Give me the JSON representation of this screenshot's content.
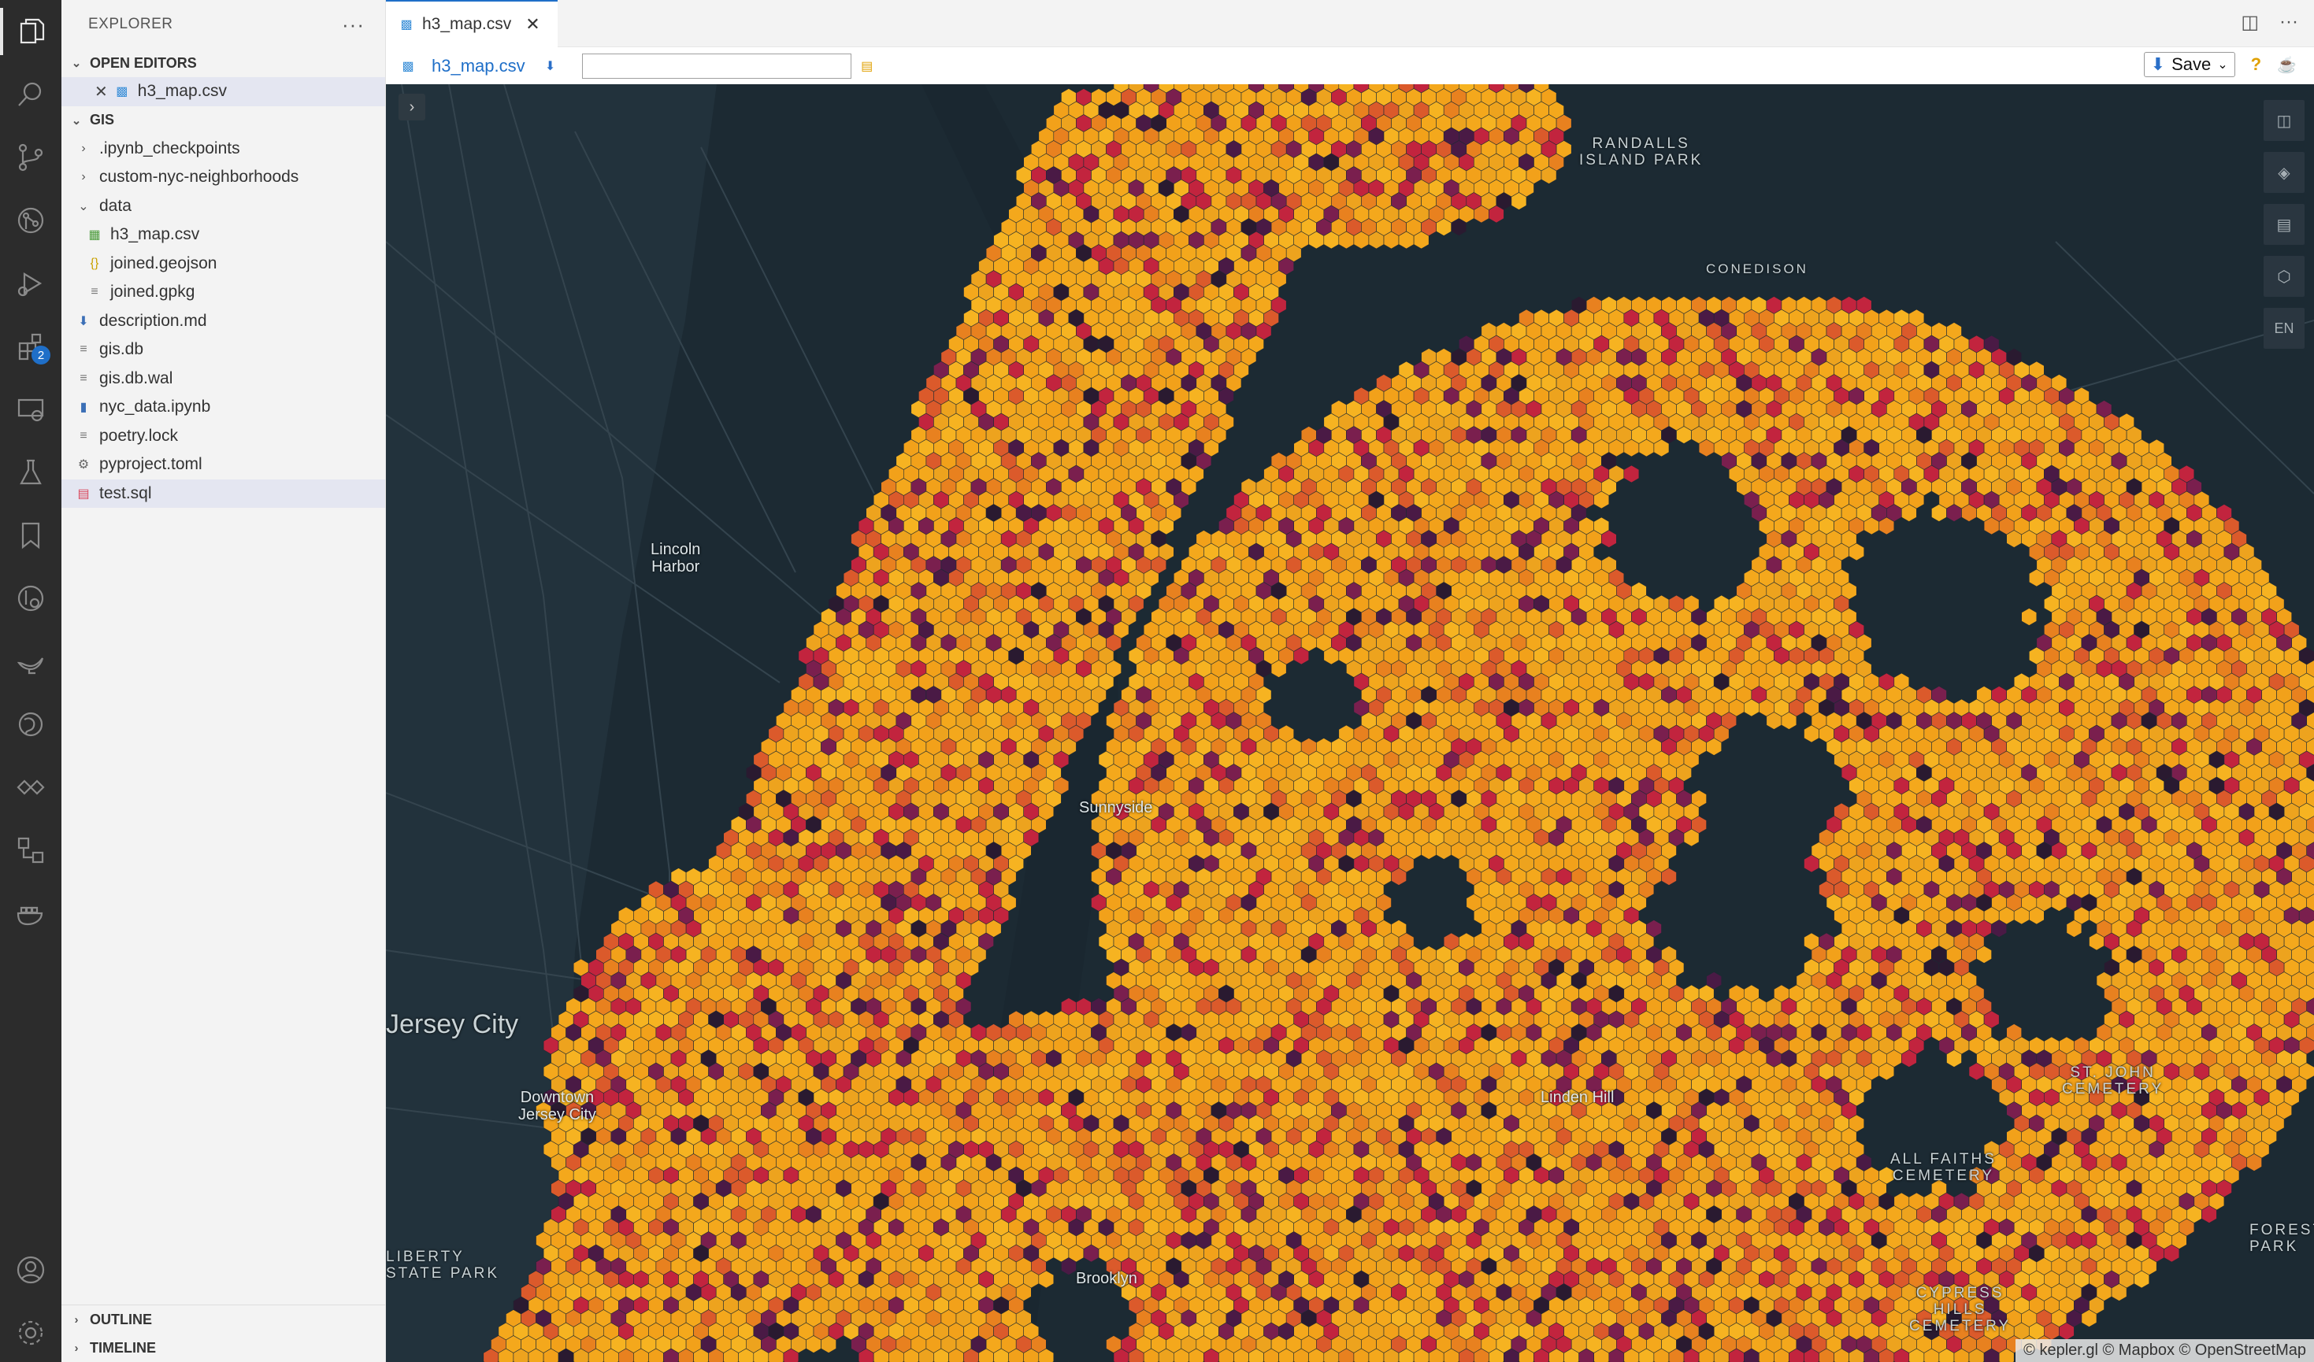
{
  "activity_bar": {
    "icons": [
      "explorer-icon",
      "search-icon",
      "source-control-icon",
      "git-graph-icon",
      "run-debug-icon",
      "extensions-icon",
      "remote-explorer-icon",
      "testing-icon",
      "bookmarks-icon",
      "gitlens-icon",
      "genie-lamp-icon",
      "python-icon",
      "kepler-icon",
      "diagram-icon",
      "docker-icon"
    ],
    "extensions_badge": "2",
    "bottom_icons": [
      "account-icon",
      "settings-gear-icon"
    ]
  },
  "sidebar": {
    "title": "EXPLORER",
    "open_editors": {
      "label": "OPEN EDITORS",
      "items": [
        {
          "name": "h3_map.csv"
        }
      ]
    },
    "workspace": {
      "label": "GIS",
      "items": [
        {
          "name": ".ipynb_checkpoints",
          "kind": "folder",
          "depth": 1
        },
        {
          "name": "custom-nyc-neighborhoods",
          "kind": "folder",
          "depth": 1
        },
        {
          "name": "data",
          "kind": "folder-open",
          "depth": 1
        },
        {
          "name": "h3_map.csv",
          "kind": "csv",
          "depth": 2
        },
        {
          "name": "joined.geojson",
          "kind": "json",
          "depth": 2
        },
        {
          "name": "joined.gpkg",
          "kind": "file",
          "depth": 2
        },
        {
          "name": "description.md",
          "kind": "md",
          "depth": 1
        },
        {
          "name": "gis.db",
          "kind": "file",
          "depth": 1
        },
        {
          "name": "gis.db.wal",
          "kind": "file",
          "depth": 1
        },
        {
          "name": "nyc_data.ipynb",
          "kind": "notebook",
          "depth": 1
        },
        {
          "name": "poetry.lock",
          "kind": "file",
          "depth": 1
        },
        {
          "name": "pyproject.toml",
          "kind": "toml",
          "depth": 1
        },
        {
          "name": "test.sql",
          "kind": "sql",
          "depth": 1
        }
      ]
    },
    "outline_label": "OUTLINE",
    "timeline_label": "TIMELINE"
  },
  "editor": {
    "tab_label": "h3_map.csv",
    "toolbar_file": "h3_map.csv",
    "input_value": "",
    "save_label": "Save",
    "help_label": "?"
  },
  "map": {
    "labels": {
      "randalls": "RANDALLS\nISLAND PARK",
      "conedison": "CONEDISON",
      "lincoln_harbor": "Lincoln\nHarbor",
      "jersey_city": "Jersey City",
      "downtown_jersey_city": "Downtown\nJersey City",
      "liberty_park": "LIBERTY\nSTATE PARK",
      "brooklyn": "Brooklyn",
      "sunnyside": "Sunnyside",
      "linden_hill": "Linden Hill",
      "all_faiths": "ALL FAITHS\nCEMETERY",
      "cypress_hills": "CYPRESS\nHILLS\nCEMETERY",
      "st_john": "ST. JOHN\nCEMETERY",
      "forest_park": "FOREST\nPARK"
    },
    "controls": [
      "split-map-icon",
      "layers-icon",
      "legend-icon",
      "draw-polygon-icon"
    ],
    "locale_label": "EN",
    "attribution": "© kepler.gl © Mapbox © OpenStreetMap"
  }
}
